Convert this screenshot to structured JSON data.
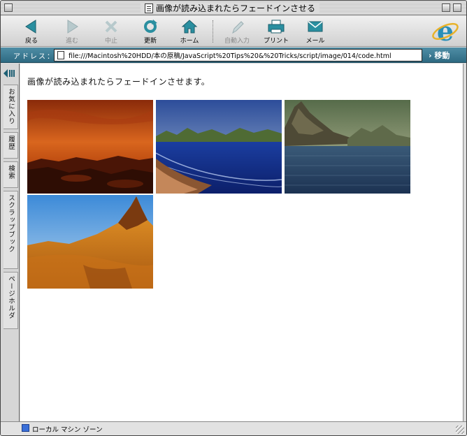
{
  "window": {
    "title": "画像が読み込まれたらフェードインさせる"
  },
  "toolbar": {
    "back": "戻る",
    "forward": "進む",
    "stop": "中止",
    "refresh": "更新",
    "home": "ホーム",
    "autofill": "自動入力",
    "print": "プリント",
    "mail": "メール"
  },
  "address": {
    "label": "アドレス：",
    "url": "file:///Macintosh%20HDD/本の原稿/JavaScript%20Tips%20&%20Tricks/script/image/014/code.html",
    "go": "移動"
  },
  "explorer": {
    "tabs": [
      "お気に入り",
      "履歴",
      "検索",
      "スクラップブック",
      "ページホルダ"
    ]
  },
  "page": {
    "heading": "画像が読み込まれたらフェードインさせます。"
  },
  "status": {
    "zone": "ローカル マシン ゾーン"
  },
  "colors": {
    "address_bar": "#3c7c94",
    "ie_blue": "#2a8fb8",
    "toolbar_icon": "#2a8fa0"
  }
}
